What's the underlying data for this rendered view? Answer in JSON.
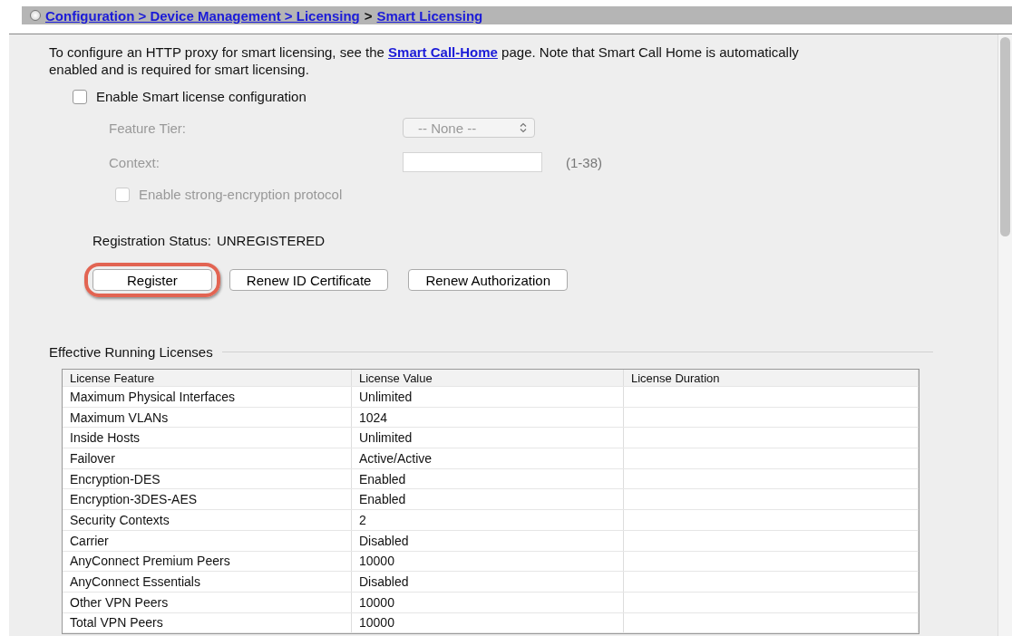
{
  "breadcrumb": {
    "path_link": "Configuration > Device Management > Licensing",
    "separator": ">",
    "current_link": "Smart Licensing"
  },
  "intro": {
    "before": "To configure an HTTP proxy for smart licensing, see the",
    "link": "Smart Call-Home",
    "after": "page. Note that Smart Call Home is automatically enabled and is required for smart licensing."
  },
  "enable_checkbox": {
    "label": "Enable Smart license configuration",
    "checked": false
  },
  "feature_tier": {
    "label": "Feature Tier:",
    "value": "-- None --",
    "disabled": true
  },
  "context": {
    "label": "Context:",
    "hint": "(1-38)",
    "disabled": true
  },
  "strong_encryption": {
    "label": "Enable strong-encryption protocol",
    "checked": false,
    "disabled": true
  },
  "registration_status": {
    "label": "Registration Status:",
    "value": "UNREGISTERED"
  },
  "buttons": [
    {
      "label": "Register",
      "highlighted": true
    },
    {
      "label": "Renew ID Certificate",
      "highlighted": false
    },
    {
      "label": "Renew Authorization",
      "highlighted": false
    }
  ],
  "licenses": {
    "title": "Effective Running Licenses",
    "columns": [
      "License Feature",
      "License Value",
      "License Duration"
    ],
    "rows": [
      [
        "Maximum Physical Interfaces",
        "Unlimited"
      ],
      [
        "Maximum VLANs",
        "1024"
      ],
      [
        "Inside Hosts",
        "Unlimited"
      ],
      [
        "Failover",
        "Active/Active"
      ],
      [
        "Encryption-DES",
        "Enabled"
      ],
      [
        "Encryption-3DES-AES",
        "Enabled"
      ],
      [
        "Security Contexts",
        "2"
      ],
      [
        "Carrier",
        "Disabled"
      ],
      [
        "AnyConnect Premium Peers",
        "10000"
      ],
      [
        "AnyConnect Essentials",
        "Disabled"
      ],
      [
        "Other VPN Peers",
        "10000"
      ],
      [
        "Total VPN Peers",
        "10000"
      ]
    ]
  }
}
